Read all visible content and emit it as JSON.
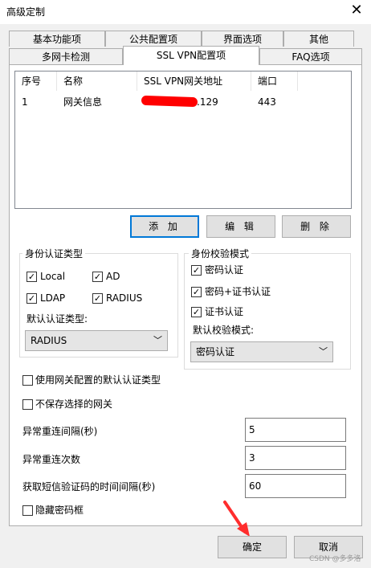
{
  "window": {
    "title": "高级定制"
  },
  "tabs_row1": [
    "基本功能项",
    "公共配置项",
    "界面选项",
    "其他"
  ],
  "tabs_row2": [
    "多网卡检测",
    "SSL VPN配置项",
    "FAQ选项"
  ],
  "gateway_list": {
    "columns": [
      "序号",
      "名称",
      "SSL VPN网关地址",
      "端口"
    ],
    "rows": [
      {
        "index": "1",
        "name": "网关信息",
        "address": ".129",
        "port": "443"
      }
    ]
  },
  "list_buttons": {
    "add": "添 加",
    "edit": "编 辑",
    "delete": "删 除"
  },
  "auth_type": {
    "title": "身份认证类型",
    "options": [
      {
        "label": "Local",
        "checked": true
      },
      {
        "label": "AD",
        "checked": true
      },
      {
        "label": "LDAP",
        "checked": true
      },
      {
        "label": "RADIUS",
        "checked": true
      }
    ],
    "default_label": "默认认证类型:",
    "default_value": "RADIUS"
  },
  "verify_mode": {
    "title": "身份校验模式",
    "options": [
      {
        "label": "密码认证",
        "checked": true
      },
      {
        "label": "密码+证书认证",
        "checked": true
      },
      {
        "label": "证书认证",
        "checked": true
      }
    ],
    "default_label": "默认校验模式:",
    "default_value": "密码认证"
  },
  "checkboxes": {
    "use_gateway_default": "使用网关配置的默认认证类型",
    "no_save_gateway": "不保存选择的网关",
    "hide_password": "隐藏密码框"
  },
  "fields": {
    "reconnect_interval": {
      "label": "异常重连间隔(秒)",
      "value": "5"
    },
    "reconnect_count": {
      "label": "异常重连次数",
      "value": "3"
    },
    "sms_interval": {
      "label": "获取短信验证码的时间间隔(秒)",
      "value": "60"
    }
  },
  "footer": {
    "ok": "确定",
    "cancel": "取消"
  },
  "watermark": "CSDN @多多洛",
  "colors": {
    "focus": "#0078d7",
    "arrow": "#ff2d2d"
  }
}
